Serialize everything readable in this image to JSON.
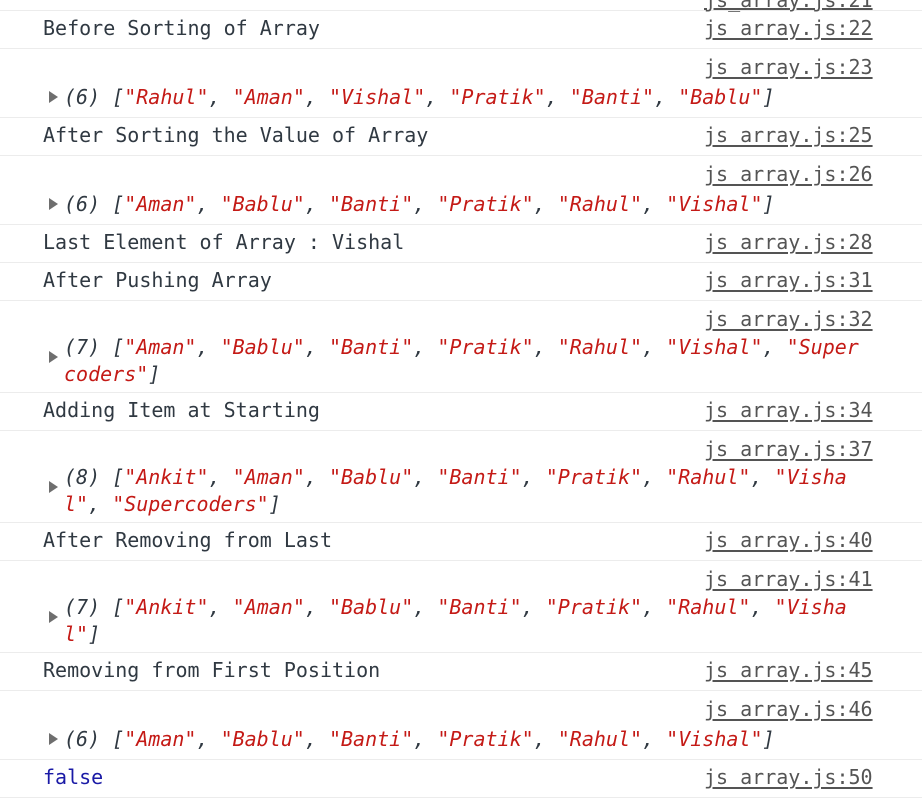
{
  "top_partial_link": "js_array.js:21",
  "rows": {
    "r1": {
      "text": "Before Sorting of Array",
      "src": "js_array.js:22"
    },
    "r2": {
      "src": "js_array.js:23",
      "count": "(6)",
      "items": [
        "Rahul",
        "Aman",
        "Vishal",
        "Pratik",
        "Banti",
        "Bablu"
      ]
    },
    "r3": {
      "text": "After Sorting the Value of Array",
      "src": "js_array.js:25"
    },
    "r4": {
      "src": "js_array.js:26",
      "count": "(6)",
      "items": [
        "Aman",
        "Bablu",
        "Banti",
        "Pratik",
        "Rahul",
        "Vishal"
      ]
    },
    "r5": {
      "text": "Last Element of Array : Vishal",
      "src": "js_array.js:28"
    },
    "r6": {
      "text": "After Pushing Array",
      "src": "js_array.js:31"
    },
    "r7": {
      "src": "js_array.js:32",
      "count": "(7)",
      "items": [
        "Aman",
        "Bablu",
        "Banti",
        "Pratik",
        "Rahul",
        "Vishal",
        "Supercoders"
      ]
    },
    "r8": {
      "text": "Adding Item at Starting",
      "src": "js_array.js:34"
    },
    "r9": {
      "src": "js_array.js:37",
      "count": "(8)",
      "items": [
        "Ankit",
        "Aman",
        "Bablu",
        "Banti",
        "Pratik",
        "Rahul",
        "Vishal",
        "Supercoders"
      ]
    },
    "r10": {
      "text": "After Removing from Last",
      "src": "js_array.js:40"
    },
    "r11": {
      "src": "js_array.js:41",
      "count": "(7)",
      "items": [
        "Ankit",
        "Aman",
        "Bablu",
        "Banti",
        "Pratik",
        "Rahul",
        "Vishal"
      ]
    },
    "r12": {
      "text": "Removing from First Position",
      "src": "js_array.js:45"
    },
    "r13": {
      "src": "js_array.js:46",
      "count": "(6)",
      "items": [
        "Aman",
        "Bablu",
        "Banti",
        "Pratik",
        "Rahul",
        "Vishal"
      ]
    },
    "r14": {
      "text": "false",
      "src": "js_array.js:50"
    }
  }
}
